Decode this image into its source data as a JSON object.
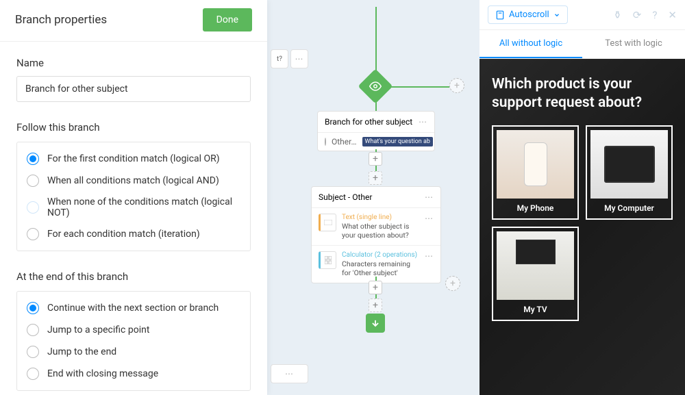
{
  "panel": {
    "title": "Branch properties",
    "done": "Done",
    "name_label": "Name",
    "name_value": "Branch for other subject",
    "follow_label": "Follow this branch",
    "follow": [
      {
        "label": "For the first condition match (logical OR)",
        "selected": true
      },
      {
        "label": "When all conditions match (logical AND)",
        "selected": false
      },
      {
        "label": "When none of the conditions match (logical NOT)",
        "selected": false
      },
      {
        "label": "For each condition match (iteration)",
        "selected": false
      }
    ],
    "end_label": "At the end of this branch",
    "end": [
      {
        "label": "Continue with the next section or branch",
        "selected": true
      },
      {
        "label": "Jump to a specific point",
        "selected": false
      },
      {
        "label": "Jump to the end",
        "selected": false
      },
      {
        "label": "End with closing message",
        "selected": false
      }
    ]
  },
  "flow": {
    "edge_text": "t?",
    "branch_card": {
      "title": "Branch for other subject",
      "cond": "Other…",
      "pill": "What's your question ab"
    },
    "section_card": {
      "title": "Subject - Other",
      "items": [
        {
          "type": "Text (single line)",
          "desc": "What other subject is your question about?"
        },
        {
          "type": "Calculator (2 operations)",
          "desc": "Characters remaining for 'Other subject'"
        }
      ]
    }
  },
  "preview": {
    "autoscroll": "Autoscroll",
    "tabs": {
      "all": "All without logic",
      "test": "Test with logic"
    },
    "question": "Which product is your support request about?",
    "options": [
      "My Phone",
      "My Computer",
      "My TV"
    ]
  }
}
